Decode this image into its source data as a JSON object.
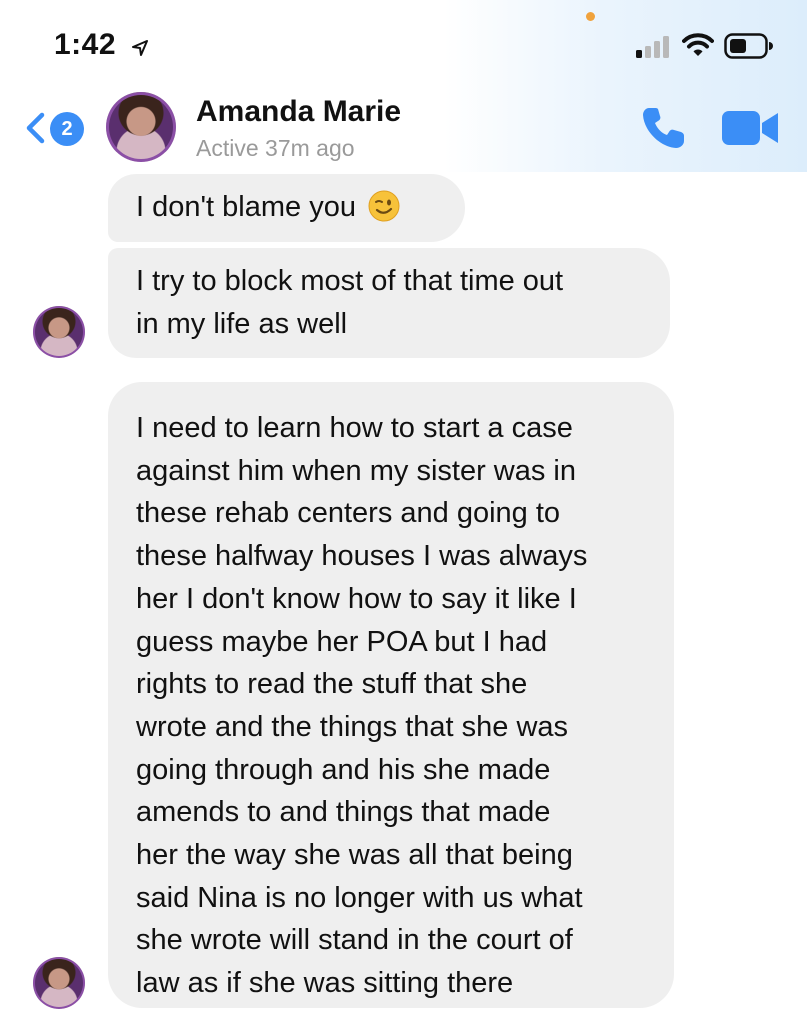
{
  "status_bar": {
    "time": "1:42",
    "icons": [
      "location-arrow-icon",
      "cellular-signal-icon",
      "wifi-icon",
      "battery-icon"
    ]
  },
  "header": {
    "back_badge_count": "2",
    "contact_name": "Amanda Marie",
    "contact_status": "Active 37m ago",
    "icons": [
      "back-chevron-icon",
      "phone-icon",
      "video-camera-icon"
    ]
  },
  "messages": [
    {
      "text": "I don't blame you",
      "emoji": "winking-face-emoji"
    },
    {
      "lines": [
        "I try to block most of that time out",
        "in my life as well"
      ]
    },
    {
      "lines": [
        "I need to learn how to start a case",
        "against him when my sister was in",
        "these rehab centers and going to",
        "these halfway houses I was always",
        "her I don't know how to say it like I",
        "guess maybe her POA but I had",
        "rights to read the stuff that she",
        "wrote and the things that she was",
        "going through and his she made",
        "amends to and things that made",
        "her the way she was all that being",
        "said Nina is no longer with us what",
        "she wrote will stand in the court of",
        "law as if she was sitting there"
      ]
    }
  ],
  "colors": {
    "accent": "#3b8ef6",
    "bubble_bg": "#efefef",
    "status_text": "#9a9a9a"
  }
}
